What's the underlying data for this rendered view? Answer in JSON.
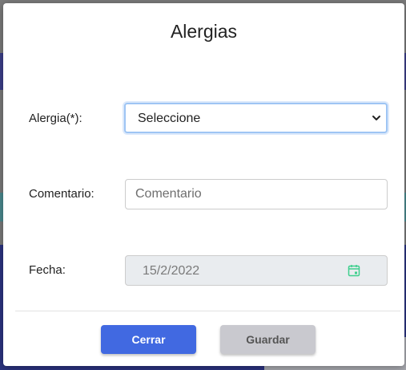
{
  "dialog": {
    "title": "Alergias"
  },
  "form": {
    "allergy": {
      "label": "Alergia(*):",
      "selected": "Seleccione"
    },
    "comment": {
      "label": "Comentario:",
      "placeholder": "Comentario",
      "value": ""
    },
    "date": {
      "label": "Fecha:",
      "value": "15/2/2022"
    }
  },
  "buttons": {
    "close_label": "Cerrar",
    "save_label": "Guardar"
  },
  "icons": {
    "select_arrow": "chevron-down-icon",
    "date_picker": "calendar-icon"
  },
  "colors": {
    "primary": "#4169e1",
    "disabled_button": "#c9c9cf",
    "calendar_icon": "#3ecf8e",
    "focus_ring": "#9ec5f4"
  }
}
